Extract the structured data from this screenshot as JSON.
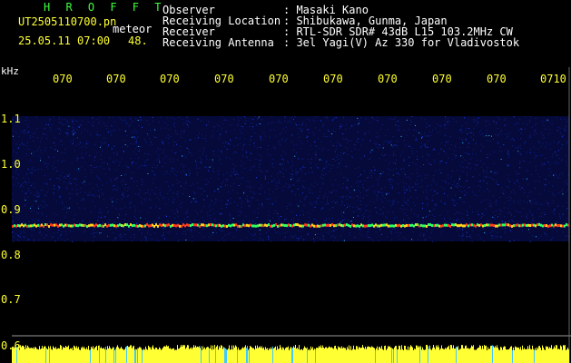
{
  "app": {
    "title": "H R O F F T"
  },
  "file": {
    "name": "UT2505110700.pn",
    "type_tag": "meteor",
    "datetime": "25.05.11 07:00",
    "count": "48."
  },
  "info": [
    {
      "label": "Observer",
      "value": ": Masaki Kano"
    },
    {
      "label": "Receiving Location",
      "value": ": Shibukawa, Gunma, Japan"
    },
    {
      "label": "Receiver",
      "value": ": RTL-SDR SDR# 43dB L15 103.2MHz CW"
    },
    {
      "label": "Receiving Antenna",
      "value": ": 3el Yagi(V) Az 330 for Vladivostok"
    }
  ],
  "axis": {
    "y_unit": "kHz",
    "x_ticks": [
      "070",
      "070",
      "070",
      "070",
      "070",
      "070",
      "070",
      "070",
      "070",
      "0710"
    ],
    "y_ticks": [
      "1.1",
      "1.0",
      "0.9",
      "0.8",
      "0.7",
      "0.6"
    ]
  },
  "colors": {
    "green": "#3cff3c",
    "yellow": "#ffff33",
    "signal_red": "#ff3c1e",
    "noise_blue": "#1e3cff"
  },
  "spectrogram": {
    "noise_band_khz": [
      0.79,
      1.02
    ],
    "carrier_khz": 0.82,
    "freq_range_khz": [
      0.6,
      1.12
    ]
  }
}
